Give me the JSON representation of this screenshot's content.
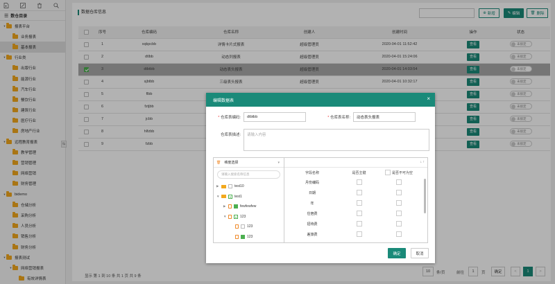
{
  "sidebar": {
    "toolbar_icons": [
      "new-file-icon",
      "edit-icon",
      "trash-icon",
      "search-icon"
    ],
    "title": "数仓目录",
    "tree": [
      {
        "label": "报表平台",
        "level": 0,
        "expanded": true
      },
      {
        "label": "业务报表",
        "level": 1
      },
      {
        "label": "基本报表",
        "level": 1,
        "selected": true
      },
      {
        "label": "行业类",
        "level": 0,
        "expanded": true
      },
      {
        "label": "出版行业",
        "level": 1
      },
      {
        "label": "能源行业",
        "level": 1
      },
      {
        "label": "汽车行业",
        "level": 1
      },
      {
        "label": "餐饮行业",
        "level": 1
      },
      {
        "label": "建筑行业",
        "level": 1
      },
      {
        "label": "医疗行业",
        "level": 1
      },
      {
        "label": "房地产行业",
        "level": 1
      },
      {
        "label": "远程教育报表",
        "level": 0,
        "expanded": true
      },
      {
        "label": "教学管理",
        "level": 1
      },
      {
        "label": "营销管理",
        "level": 1
      },
      {
        "label": "网络营销",
        "level": 1
      },
      {
        "label": "财务管理",
        "level": 1
      },
      {
        "label": "bidemo",
        "level": 0,
        "expanded": true
      },
      {
        "label": "仓储分析",
        "level": 1
      },
      {
        "label": "采购分析",
        "level": 1
      },
      {
        "label": "人员分析",
        "level": 1
      },
      {
        "label": "销售分析",
        "level": 1
      },
      {
        "label": "财务分析",
        "level": 1
      },
      {
        "label": "报表测试",
        "level": 0,
        "expanded": true
      },
      {
        "label": "网络营销报表",
        "level": 1,
        "expanded": true
      },
      {
        "label": "有效详情表",
        "level": 2
      }
    ]
  },
  "main": {
    "title": "数据仓库信息",
    "buttons": {
      "add": "新增",
      "edit": "编辑",
      "delete": "删除"
    },
    "table": {
      "headers": [
        "序号",
        "仓库编码",
        "仓库名称",
        "创建人",
        "创建时间",
        "操作",
        "状态"
      ],
      "rows": [
        {
          "no": "1",
          "code": "xqkpcbb",
          "name": "详情卡片式报表",
          "creator": "超级管理员",
          "time": "2020-04-01 11:52:42",
          "action": "查看",
          "status": "未锁定",
          "checked": false
        },
        {
          "no": "2",
          "code": "dtlbb",
          "name": "动态列报表",
          "creator": "超级管理员",
          "time": "2020-04-01 15:24:06",
          "action": "查看",
          "status": "未锁定",
          "checked": false
        },
        {
          "no": "3",
          "code": "dtbtbb",
          "name": "动态表头报表",
          "creator": "超级管理员",
          "time": "2020-04-01 14:03:54",
          "action": "查看",
          "status": "未锁定",
          "checked": true
        },
        {
          "no": "4",
          "code": "sjbtbb",
          "name": "三级表头报表",
          "creator": "超级管理员",
          "time": "2020-04-01 10:32:17",
          "action": "查看",
          "status": "未锁定",
          "checked": false
        },
        {
          "no": "5",
          "code": "flbb",
          "name": "",
          "creator": "",
          "time": "",
          "action": "查看",
          "status": "未锁定",
          "checked": false
        },
        {
          "no": "6",
          "code": "fztjbb",
          "name": "",
          "creator": "",
          "time": "",
          "action": "查看",
          "status": "未锁定",
          "checked": false
        },
        {
          "no": "7",
          "code": "jcbb",
          "name": "",
          "creator": "",
          "time": "",
          "action": "查看",
          "status": "未锁定",
          "checked": false
        },
        {
          "no": "8",
          "code": "hlfzbb",
          "name": "",
          "creator": "",
          "time": "",
          "action": "查看",
          "status": "未锁定",
          "checked": false
        },
        {
          "no": "9",
          "code": "fzbb",
          "name": "",
          "creator": "",
          "time": "",
          "action": "查看",
          "status": "未锁定",
          "checked": false
        }
      ]
    },
    "footer": {
      "info": "显示 第 1 到 10 条 共 1 页 共 9 条",
      "page_size": "10",
      "page_size_suffix": "条/页",
      "goto_label": "前往",
      "goto_page": "1",
      "page_unit": "页",
      "confirm": "确定",
      "prev": "<",
      "current": "1",
      "next": ">"
    }
  },
  "modal": {
    "title": "编辑数据表",
    "close": "×",
    "code_label": "仓库表编码:",
    "code_value": "dtbtbb",
    "name_label": "仓库表名称:",
    "name_value": "动态表头报表",
    "desc_label": "仓库表描述:",
    "desc_placeholder": "请输入内容",
    "tree_select_label": "维度选择",
    "tree_search_placeholder": "请输入搜索名称信息",
    "tree": [
      {
        "label": "test10",
        "level": 0,
        "icon": "folder",
        "check": "none",
        "arrow": "right"
      },
      {
        "label": "test1",
        "level": 0,
        "icon": "folder",
        "check": "part",
        "arrow": "down"
      },
      {
        "label": "fewfewfew",
        "level": 1,
        "icon": "doc",
        "check": "on",
        "arrow": "right"
      },
      {
        "label": "123",
        "level": 1,
        "icon": "doc",
        "check": "part",
        "arrow": "down"
      },
      {
        "label": "123",
        "level": 2,
        "icon": "doc",
        "check": "none",
        "arrow": ""
      },
      {
        "label": "123",
        "level": 2,
        "icon": "doc",
        "check": "on",
        "arrow": ""
      }
    ],
    "field_headers": [
      "字段名称",
      "是否主键",
      "是否不可为空"
    ],
    "fields": [
      "月份编码",
      "日期",
      "年",
      "住宿费",
      "招待费",
      "差旅费"
    ],
    "confirm": "确定",
    "cancel": "取消"
  },
  "colors": {
    "accent": "#1a8a79",
    "folder": "#f2a81d",
    "highlight_row": "#a9a9a9"
  }
}
